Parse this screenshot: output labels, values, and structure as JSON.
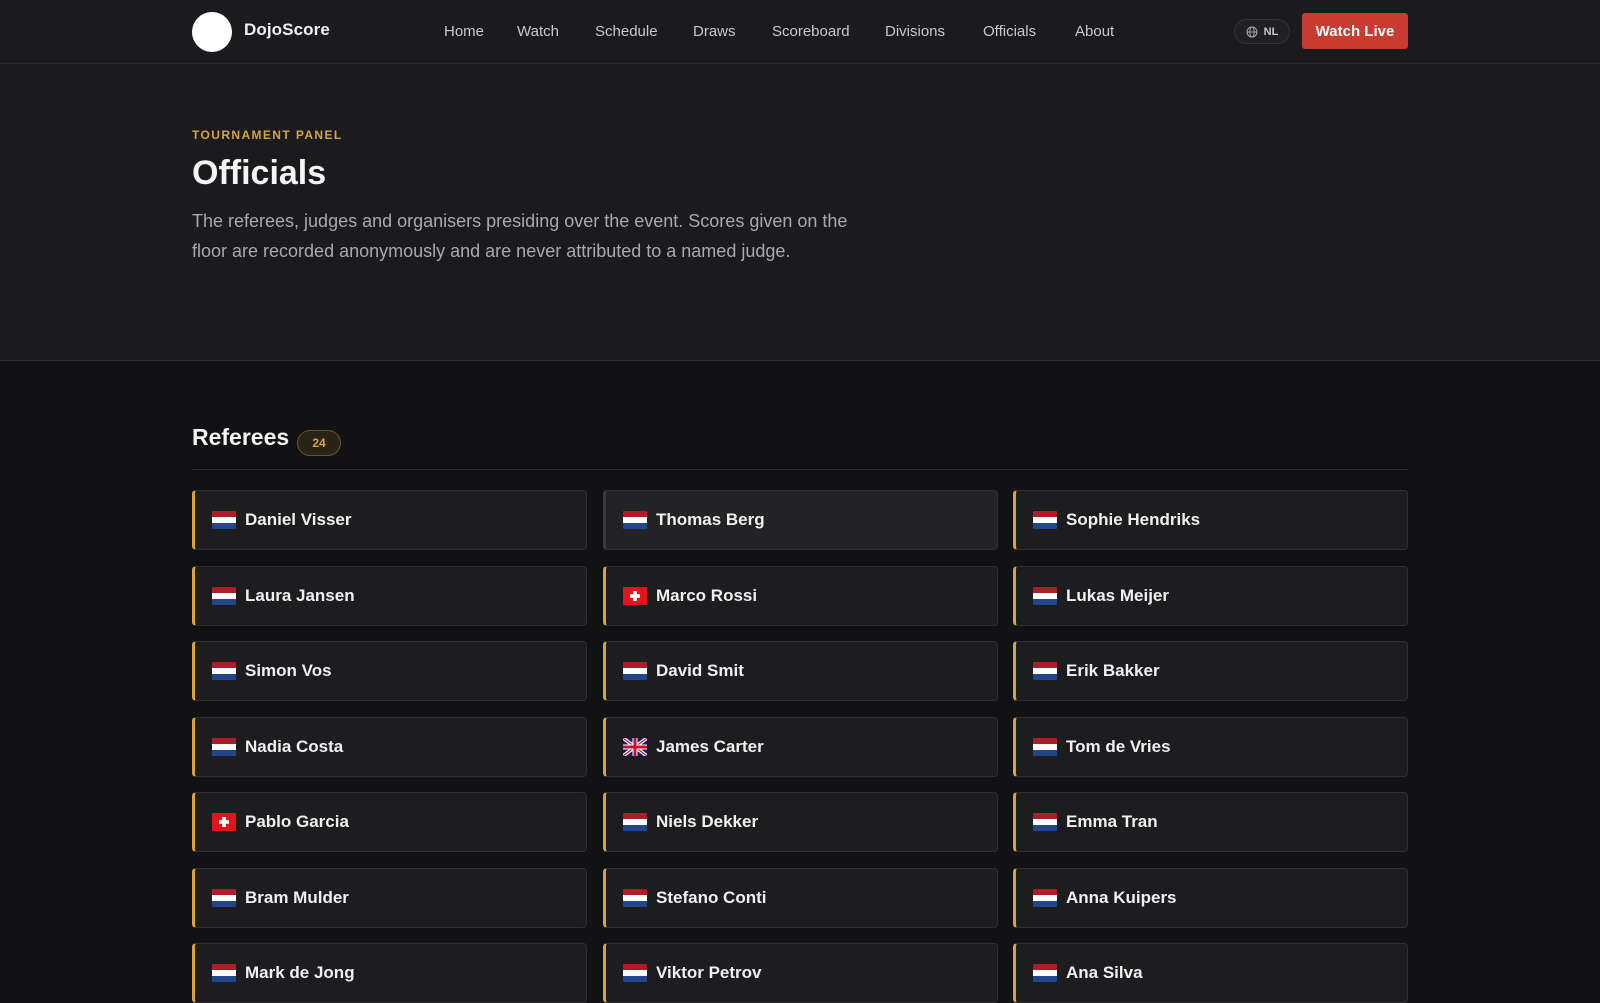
{
  "header": {
    "brand": "DojoScore",
    "nav": [
      {
        "label": "Home",
        "name": "nav-home"
      },
      {
        "label": "Watch",
        "name": "nav-watch"
      },
      {
        "label": "Schedule",
        "name": "nav-schedule"
      },
      {
        "label": "Draws",
        "name": "nav-draws"
      },
      {
        "label": "Scoreboard",
        "name": "nav-scoreboard"
      },
      {
        "label": "Divisions",
        "name": "nav-divisions"
      },
      {
        "label": "Officials",
        "name": "nav-officials"
      },
      {
        "label": "About",
        "name": "nav-about"
      }
    ],
    "language": "NL",
    "language_icon": "globe-icon",
    "watch_live": "Watch Live"
  },
  "hero": {
    "eyebrow": "TOURNAMENT PANEL",
    "title": "Officials",
    "description": "The referees, judges and organisers presiding over the event. Scores given on the floor are recorded anonymously and are never attributed to a named judge."
  },
  "referees": {
    "title": "Referees",
    "count": "24",
    "items": [
      {
        "name": "Daniel Visser",
        "flag": "nl"
      },
      {
        "name": "Thomas Berg",
        "flag": "nl"
      },
      {
        "name": "Sophie Hendriks",
        "flag": "nl"
      },
      {
        "name": "Laura Jansen",
        "flag": "nl"
      },
      {
        "name": "Marco Rossi",
        "flag": "ch"
      },
      {
        "name": "Lukas Meijer",
        "flag": "nl"
      },
      {
        "name": "Simon Vos",
        "flag": "nl"
      },
      {
        "name": "David Smit",
        "flag": "nl"
      },
      {
        "name": "Erik Bakker",
        "flag": "nl"
      },
      {
        "name": "Nadia Costa",
        "flag": "nl"
      },
      {
        "name": "James Carter",
        "flag": "gb"
      },
      {
        "name": "Tom de Vries",
        "flag": "nl"
      },
      {
        "name": "Pablo Garcia",
        "flag": "ch"
      },
      {
        "name": "Niels Dekker",
        "flag": "nl"
      },
      {
        "name": "Emma Tran",
        "flag": "nl"
      },
      {
        "name": "Bram Mulder",
        "flag": "nl"
      },
      {
        "name": "Stefano Conti",
        "flag": "nl"
      },
      {
        "name": "Anna Kuipers",
        "flag": "nl"
      },
      {
        "name": "Mark de Jong",
        "flag": "nl"
      },
      {
        "name": "Viktor Petrov",
        "flag": "nl"
      },
      {
        "name": "Ana Silva",
        "flag": "nl"
      }
    ]
  },
  "colors": {
    "accent": "#d6a53a",
    "live_button": "#c93a30",
    "background": "#121214",
    "surface": "#1b1b1e"
  }
}
